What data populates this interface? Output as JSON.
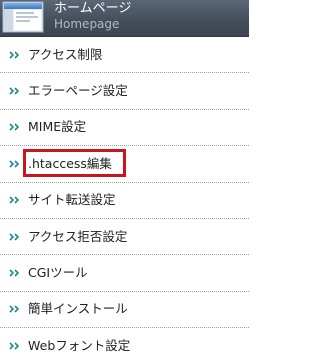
{
  "header": {
    "title": "ホームページ",
    "subtitle": "Homepage",
    "icon": "monitor-window-icon",
    "colors": {
      "background": "#454f5c",
      "title": "#ffffff",
      "subtitle": "#aeb9c5"
    }
  },
  "menu": {
    "items": [
      {
        "label": "アクセス制限"
      },
      {
        "label": "エラーページ設定"
      },
      {
        "label": "MIME設定"
      },
      {
        "label": ".htaccess編集",
        "highlighted": true
      },
      {
        "label": "サイト転送設定"
      },
      {
        "label": "アクセス拒否設定"
      },
      {
        "label": "CGIツール"
      },
      {
        "label": "簡単インストール"
      },
      {
        "label": "Webフォント設定"
      }
    ],
    "item_icon": "double-chevron-right-icon",
    "colors": {
      "arrow": "#1d8a9a",
      "text": "#222222",
      "highlight": "#c8161d"
    }
  }
}
